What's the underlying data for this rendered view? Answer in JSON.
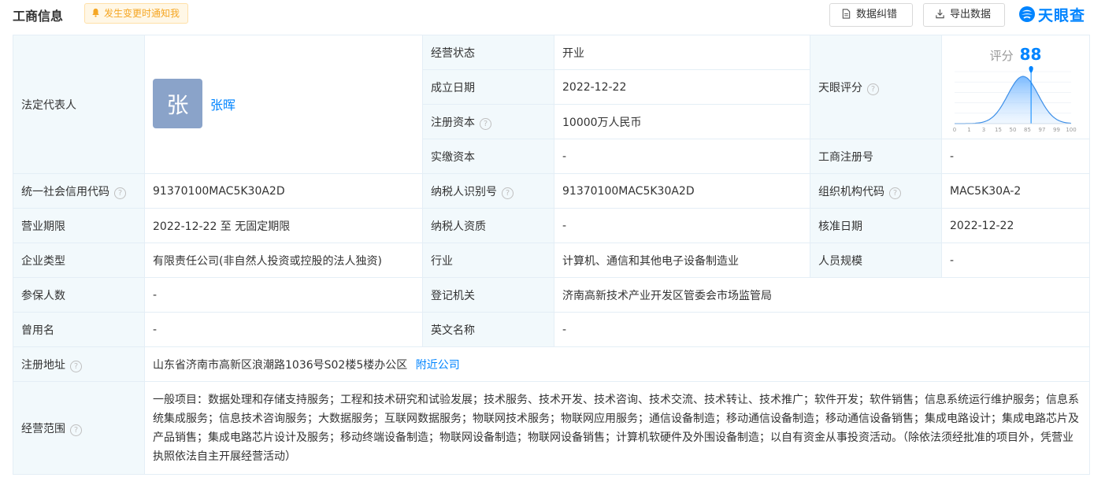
{
  "header": {
    "title": "工商信息",
    "notify_label": "发生变更时通知我",
    "correct_label": "数据纠错",
    "export_label": "导出数据",
    "logo_text": "天眼查"
  },
  "legal_rep": {
    "label": "法定代表人",
    "avatar_char": "张",
    "name": "张晖"
  },
  "score": {
    "label": "天眼评分",
    "chart_label": "评分",
    "value": "88",
    "axis_ticks": [
      "0",
      "1",
      "3",
      "15",
      "50",
      "85",
      "97",
      "99",
      "100"
    ]
  },
  "rows": {
    "status": {
      "label": "经营状态",
      "value": "开业"
    },
    "founded": {
      "label": "成立日期",
      "value": "2022-12-22"
    },
    "capital": {
      "label": "注册资本",
      "value": "10000万人民币"
    },
    "paid_capital": {
      "label": "实缴资本",
      "value": "-"
    },
    "reg_no": {
      "label": "工商注册号",
      "value": "-"
    },
    "credit_code": {
      "label": "统一社会信用代码",
      "value": "91370100MAC5K30A2D"
    },
    "taxpayer_id": {
      "label": "纳税人识别号",
      "value": "91370100MAC5K30A2D"
    },
    "org_code": {
      "label": "组织机构代码",
      "value": "MAC5K30A-2"
    },
    "term": {
      "label": "营业期限",
      "value": "2022-12-22 至 无固定期限"
    },
    "taxpayer_qual": {
      "label": "纳税人资质",
      "value": "-"
    },
    "approved": {
      "label": "核准日期",
      "value": "2022-12-22"
    },
    "company_type": {
      "label": "企业类型",
      "value": "有限责任公司(非自然人投资或控股的法人独资)"
    },
    "industry": {
      "label": "行业",
      "value": "计算机、通信和其他电子设备制造业"
    },
    "staff_size": {
      "label": "人员规模",
      "value": "-"
    },
    "insured": {
      "label": "参保人数",
      "value": "-"
    },
    "authority": {
      "label": "登记机关",
      "value": "济南高新技术产业开发区管委会市场监管局"
    },
    "former_name": {
      "label": "曾用名",
      "value": "-"
    },
    "english_name": {
      "label": "英文名称",
      "value": "-"
    },
    "address": {
      "label": "注册地址",
      "value": "山东省济南市高新区浪潮路1036号S02楼5楼办公区",
      "nearby_link": "附近公司"
    },
    "scope": {
      "label": "经营范围",
      "value": "一般项目：数据处理和存储支持服务；工程和技术研究和试验发展；技术服务、技术开发、技术咨询、技术交流、技术转让、技术推广；软件开发；软件销售；信息系统运行维护服务；信息系统集成服务；信息技术咨询服务；大数据服务；互联网数据服务；物联网技术服务；物联网应用服务；通信设备制造；移动通信设备制造；移动通信设备销售；集成电路设计；集成电路芯片及产品销售；集成电路芯片设计及服务；移动终端设备制造；物联网设备制造；物联网设备销售；计算机软硬件及外围设备制造；以自有资金从事投资活动。（除依法须经批准的项目外，凭营业执照依法自主开展经营活动）"
    }
  },
  "colors": {
    "accent": "#0084ff",
    "label_bg": "#f2f9fc",
    "border": "#e4eef6",
    "notify_bg": "#fff7e6",
    "notify_text": "#f5a623",
    "avatar_bg": "#8aa3c9"
  },
  "icons": {
    "notify": "bell-icon",
    "correct": "document-icon",
    "export": "download-icon",
    "help": "question-circle-icon",
    "logo": "tianyancha-logo-icon"
  }
}
